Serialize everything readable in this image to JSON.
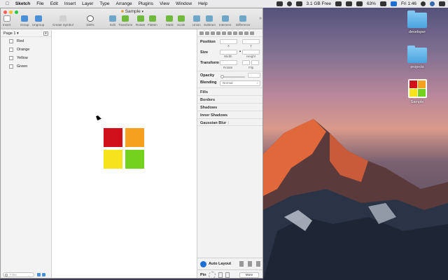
{
  "menubar": {
    "app": "Sketch",
    "items": [
      "File",
      "Edit",
      "Insert",
      "Layer",
      "Type",
      "Arrange",
      "Plugins",
      "View",
      "Window",
      "Help"
    ],
    "disk": "3.1 GB Free",
    "battery": "63%",
    "clock": "Fri 1:46"
  },
  "window": {
    "title": "Sample",
    "toolbar": [
      {
        "label": "Insert",
        "icon": "plus-icon"
      },
      {
        "label": "Group",
        "icon": "group-icon"
      },
      {
        "label": "Ungroup",
        "icon": "ungroup-icon"
      },
      {
        "label": "Create Symbol",
        "icon": "symbol-icon"
      },
      {
        "label": "100%",
        "icon": "zoom-icon"
      },
      {
        "label": "Edit",
        "icon": "edit-icon"
      },
      {
        "label": "Transform",
        "icon": "transform-icon"
      },
      {
        "label": "Rotate",
        "icon": "rotate-icon"
      },
      {
        "label": "Flatten",
        "icon": "flatten-icon"
      },
      {
        "label": "Mask",
        "icon": "mask-icon"
      },
      {
        "label": "Scale",
        "icon": "scale-icon"
      },
      {
        "label": "Union",
        "icon": "union-icon"
      },
      {
        "label": "Subtract",
        "icon": "subtract-icon"
      },
      {
        "label": "Intersect",
        "icon": "intersect-icon"
      },
      {
        "label": "Difference",
        "icon": "difference-icon"
      }
    ]
  },
  "layers": {
    "page": "Page 1",
    "items": [
      {
        "name": "Red"
      },
      {
        "name": "Orange"
      },
      {
        "name": "Yellow"
      },
      {
        "name": "Green"
      }
    ],
    "filter_placeholder": "Filter"
  },
  "canvas": {
    "colors": {
      "red": "#d0101a",
      "orange": "#f5a01f",
      "yellow": "#f7e31c",
      "green": "#74d11e"
    }
  },
  "inspector": {
    "position": "Position",
    "x_label": "X",
    "y_label": "Y",
    "size": "Size",
    "width_label": "Width",
    "height_label": "Height",
    "transform": "Transform",
    "rotate_label": "Rotate",
    "flip_label": "Flip",
    "opacity": "Opacity",
    "blending": "Blending",
    "blending_value": "Normal",
    "sections": [
      "Fills",
      "Borders",
      "Shadows",
      "Inner Shadows",
      "Gaussian Blur"
    ],
    "auto_layout": "Auto Layout",
    "pin": "Pin",
    "more": "More"
  },
  "desktop": {
    "icons": [
      {
        "label": "developer",
        "type": "folder"
      },
      {
        "label": "projects",
        "type": "folder"
      },
      {
        "label": "Sample",
        "type": "sketch-file"
      }
    ]
  }
}
